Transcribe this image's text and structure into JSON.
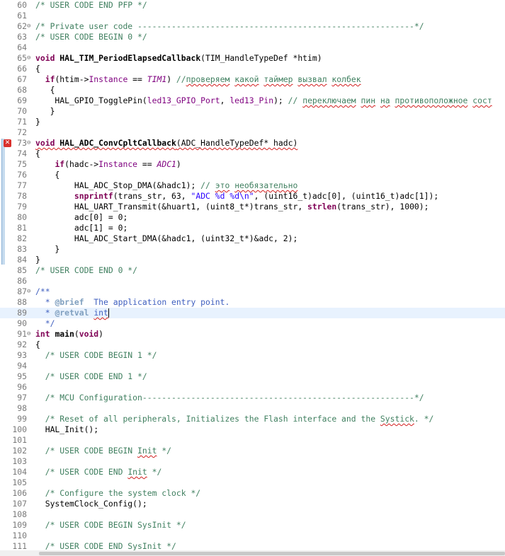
{
  "lines": [
    {
      "n": "60",
      "segs": [
        {
          "c": "cm",
          "t": "/* USER CODE END PFP */"
        }
      ]
    },
    {
      "n": "61",
      "segs": []
    },
    {
      "n": "62",
      "fold": "⊖",
      "segs": [
        {
          "c": "cm",
          "t": "/* Private user code ---------------------------------------------------------*/"
        }
      ]
    },
    {
      "n": "63",
      "segs": [
        {
          "c": "cm",
          "t": "/* USER CODE BEGIN 0 */"
        }
      ]
    },
    {
      "n": "64",
      "segs": []
    },
    {
      "n": "65",
      "fold": "⊖",
      "segs": [
        {
          "c": "kw",
          "t": "void"
        },
        {
          "c": "",
          "t": " "
        },
        {
          "c": "fn",
          "t": "HAL_TIM_PeriodElapsedCallback"
        },
        {
          "c": "",
          "t": "(TIM_HandleTypeDef *htim)"
        }
      ]
    },
    {
      "n": "66",
      "segs": [
        {
          "c": "",
          "t": "{"
        }
      ]
    },
    {
      "n": "67",
      "segs": [
        {
          "c": "",
          "t": "  "
        },
        {
          "c": "kw",
          "t": "if"
        },
        {
          "c": "",
          "t": "(htim->"
        },
        {
          "c": "mac",
          "t": "Instance"
        },
        {
          "c": "",
          "t": " == "
        },
        {
          "c": "mac it",
          "t": "TIM1"
        },
        {
          "c": "",
          "t": ") "
        },
        {
          "c": "cm",
          "t": "//"
        },
        {
          "c": "cm sq",
          "t": "проверяем"
        },
        {
          "c": "cm",
          "t": " "
        },
        {
          "c": "cm sq",
          "t": "какой"
        },
        {
          "c": "cm",
          "t": " "
        },
        {
          "c": "cm sq",
          "t": "таймер"
        },
        {
          "c": "cm",
          "t": " "
        },
        {
          "c": "cm sq",
          "t": "вызвал"
        },
        {
          "c": "cm",
          "t": " "
        },
        {
          "c": "cm sq",
          "t": "колбек"
        }
      ]
    },
    {
      "n": "68",
      "segs": [
        {
          "c": "",
          "t": "   {"
        }
      ]
    },
    {
      "n": "69",
      "segs": [
        {
          "c": "",
          "t": "    HAL_GPIO_TogglePin("
        },
        {
          "c": "mac",
          "t": "led13_GPIO_Port"
        },
        {
          "c": "",
          "t": ", "
        },
        {
          "c": "mac",
          "t": "led13_Pin"
        },
        {
          "c": "",
          "t": "); "
        },
        {
          "c": "cm",
          "t": "// "
        },
        {
          "c": "cm sq",
          "t": "переключаем"
        },
        {
          "c": "cm",
          "t": " "
        },
        {
          "c": "cm sq",
          "t": "пин"
        },
        {
          "c": "cm",
          "t": " "
        },
        {
          "c": "cm sq",
          "t": "на"
        },
        {
          "c": "cm",
          "t": " "
        },
        {
          "c": "cm sq",
          "t": "противоположное"
        },
        {
          "c": "cm",
          "t": " "
        },
        {
          "c": "cm sq",
          "t": "сост"
        }
      ]
    },
    {
      "n": "70",
      "segs": [
        {
          "c": "",
          "t": "   }"
        }
      ]
    },
    {
      "n": "71",
      "segs": [
        {
          "c": "",
          "t": "}"
        }
      ]
    },
    {
      "n": "72",
      "segs": []
    },
    {
      "n": "73",
      "fold": "⊖",
      "err": true,
      "segs": [
        {
          "c": "kw sq",
          "t": "void"
        },
        {
          "c": "sq",
          "t": " "
        },
        {
          "c": "fn sq",
          "t": "HAL_ADC_ConvCpltCallback"
        },
        {
          "c": "sq",
          "t": "(ADC_HandleTypeDef* hadc)"
        }
      ]
    },
    {
      "n": "74",
      "segs": [
        {
          "c": "",
          "t": "{"
        }
      ]
    },
    {
      "n": "75",
      "segs": [
        {
          "c": "",
          "t": "    "
        },
        {
          "c": "kw",
          "t": "if"
        },
        {
          "c": "",
          "t": "(hadc->"
        },
        {
          "c": "mac",
          "t": "Instance"
        },
        {
          "c": "",
          "t": " == "
        },
        {
          "c": "mac it",
          "t": "ADC1"
        },
        {
          "c": "",
          "t": ")"
        }
      ]
    },
    {
      "n": "76",
      "segs": [
        {
          "c": "",
          "t": "    {"
        }
      ]
    },
    {
      "n": "77",
      "segs": [
        {
          "c": "",
          "t": "        HAL_ADC_Stop_DMA(&hadc1); "
        },
        {
          "c": "cm",
          "t": "// "
        },
        {
          "c": "cm sq",
          "t": "это"
        },
        {
          "c": "cm",
          "t": " "
        },
        {
          "c": "cm sq",
          "t": "необязательно"
        }
      ]
    },
    {
      "n": "78",
      "segs": [
        {
          "c": "",
          "t": "        "
        },
        {
          "c": "kw",
          "t": "snprintf"
        },
        {
          "c": "",
          "t": "(trans_str, 63, "
        },
        {
          "c": "str",
          "t": "\"ADC %d %d\\n\""
        },
        {
          "c": "",
          "t": ", (uint16_t)adc[0], (uint16_t)adc[1]);"
        }
      ]
    },
    {
      "n": "79",
      "segs": [
        {
          "c": "",
          "t": "        HAL_UART_Transmit(&huart1, (uint8_t*)trans_str, "
        },
        {
          "c": "kw",
          "t": "strlen"
        },
        {
          "c": "",
          "t": "(trans_str), 1000);"
        }
      ]
    },
    {
      "n": "80",
      "segs": [
        {
          "c": "",
          "t": "        adc[0] = 0;"
        }
      ]
    },
    {
      "n": "81",
      "segs": [
        {
          "c": "",
          "t": "        adc[1] = 0;"
        }
      ]
    },
    {
      "n": "82",
      "segs": [
        {
          "c": "",
          "t": "        HAL_ADC_Start_DMA(&hadc1, (uint32_t*)&adc, 2);"
        }
      ]
    },
    {
      "n": "83",
      "segs": [
        {
          "c": "",
          "t": "    }"
        }
      ]
    },
    {
      "n": "84",
      "segs": [
        {
          "c": "",
          "t": "}"
        }
      ]
    },
    {
      "n": "85",
      "segs": [
        {
          "c": "cm",
          "t": "/* USER CODE END 0 */"
        }
      ]
    },
    {
      "n": "86",
      "segs": []
    },
    {
      "n": "87",
      "fold": "⊖",
      "segs": [
        {
          "c": "doc",
          "t": "/**"
        }
      ]
    },
    {
      "n": "88",
      "segs": [
        {
          "c": "doc",
          "t": "  * "
        },
        {
          "c": "tag",
          "t": "@brief"
        },
        {
          "c": "doc",
          "t": "  The application entry point."
        }
      ]
    },
    {
      "n": "89",
      "current": true,
      "segs": [
        {
          "c": "doc",
          "t": "  * "
        },
        {
          "c": "tag",
          "t": "@retval"
        },
        {
          "c": "doc",
          "t": " "
        },
        {
          "c": "doc sq",
          "t": "int"
        }
      ]
    },
    {
      "n": "90",
      "segs": [
        {
          "c": "doc",
          "t": "  */"
        }
      ]
    },
    {
      "n": "91",
      "fold": "⊖",
      "segs": [
        {
          "c": "kw",
          "t": "int"
        },
        {
          "c": "",
          "t": " "
        },
        {
          "c": "fn",
          "t": "main"
        },
        {
          "c": "",
          "t": "("
        },
        {
          "c": "kw",
          "t": "void"
        },
        {
          "c": "",
          "t": ")"
        }
      ]
    },
    {
      "n": "92",
      "segs": [
        {
          "c": "",
          "t": "{"
        }
      ]
    },
    {
      "n": "93",
      "segs": [
        {
          "c": "",
          "t": "  "
        },
        {
          "c": "cm",
          "t": "/* USER CODE BEGIN 1 */"
        }
      ]
    },
    {
      "n": "94",
      "segs": []
    },
    {
      "n": "95",
      "segs": [
        {
          "c": "",
          "t": "  "
        },
        {
          "c": "cm",
          "t": "/* USER CODE END 1 */"
        }
      ]
    },
    {
      "n": "96",
      "segs": []
    },
    {
      "n": "97",
      "segs": [
        {
          "c": "",
          "t": "  "
        },
        {
          "c": "cm",
          "t": "/* MCU Configuration--------------------------------------------------------*/"
        }
      ]
    },
    {
      "n": "98",
      "segs": []
    },
    {
      "n": "99",
      "segs": [
        {
          "c": "",
          "t": "  "
        },
        {
          "c": "cm",
          "t": "/* Reset of all peripherals, Initializes the Flash interface and the "
        },
        {
          "c": "cm sq",
          "t": "Systick"
        },
        {
          "c": "cm",
          "t": ". */"
        }
      ]
    },
    {
      "n": "100",
      "segs": [
        {
          "c": "",
          "t": "  HAL_Init();"
        }
      ]
    },
    {
      "n": "101",
      "segs": []
    },
    {
      "n": "102",
      "segs": [
        {
          "c": "",
          "t": "  "
        },
        {
          "c": "cm",
          "t": "/* USER CODE BEGIN "
        },
        {
          "c": "cm sq",
          "t": "Init"
        },
        {
          "c": "cm",
          "t": " */"
        }
      ]
    },
    {
      "n": "103",
      "segs": []
    },
    {
      "n": "104",
      "segs": [
        {
          "c": "",
          "t": "  "
        },
        {
          "c": "cm",
          "t": "/* USER CODE END "
        },
        {
          "c": "cm sq",
          "t": "Init"
        },
        {
          "c": "cm",
          "t": " */"
        }
      ]
    },
    {
      "n": "105",
      "segs": []
    },
    {
      "n": "106",
      "segs": [
        {
          "c": "",
          "t": "  "
        },
        {
          "c": "cm",
          "t": "/* Configure the system clock */"
        }
      ]
    },
    {
      "n": "107",
      "segs": [
        {
          "c": "",
          "t": "  SystemClock_Config();"
        }
      ]
    },
    {
      "n": "108",
      "segs": []
    },
    {
      "n": "109",
      "segs": [
        {
          "c": "",
          "t": "  "
        },
        {
          "c": "cm",
          "t": "/* USER CODE BEGIN SysInit */"
        }
      ]
    },
    {
      "n": "110",
      "segs": []
    },
    {
      "n": "111",
      "segs": [
        {
          "c": "",
          "t": "  "
        },
        {
          "c": "cm",
          "t": "/* USER CODE END SysInit */"
        }
      ]
    }
  ],
  "error_icon": "error-x-icon",
  "error_glyph": "✕"
}
